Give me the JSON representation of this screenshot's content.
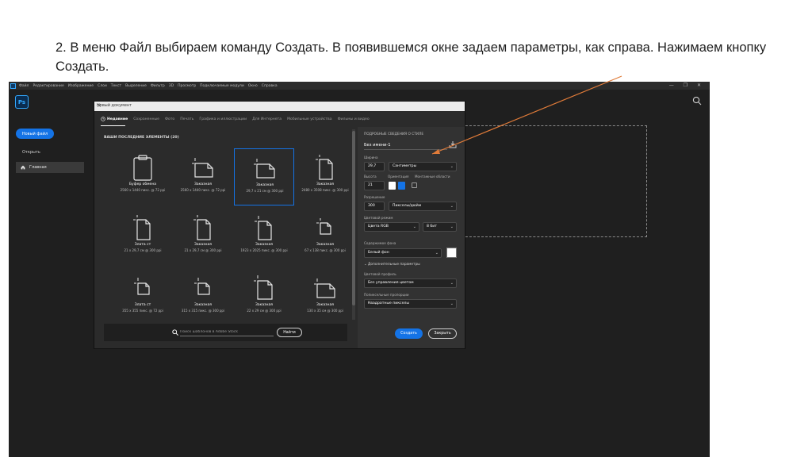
{
  "slide": {
    "instruction": "2. В меню Файл выбираем команду Создать. В появившемся окне задаем параметры, как справа. Нажимаем кнопку Создать."
  },
  "menubar": {
    "items": [
      "Файл",
      "Редактирование",
      "Изображение",
      "Слои",
      "Текст",
      "Выделение",
      "Фильтр",
      "3D",
      "Просмотр",
      "Подключаемые модули",
      "Окно",
      "Справка"
    ],
    "window_controls": "— ❐ ✕"
  },
  "sidebar": {
    "logo": "Ps",
    "new_file": "Новый файл",
    "open": "Открыть",
    "home": "Главная"
  },
  "dialog": {
    "title": "Новый документ",
    "close": "×",
    "tabs": [
      "Недавние",
      "Сохраненные",
      "Фото",
      "Печать",
      "Графика и иллюстрации",
      "Для Интернета",
      "Мобильные устройства",
      "Фильмы и видео"
    ],
    "section_header": "ВАШИ ПОСЛЕДНИЕ ЭЛЕМЕНТЫ (20)",
    "presets": [
      {
        "name": "Буфер обмена",
        "desc": "2560 x 1440 пикс. @ 72 ppi"
      },
      {
        "name": "Заказная",
        "desc": "2560 x 1440 пикс. @ 72 ppi"
      },
      {
        "name": "Заказная",
        "desc": "29,7 x 21 см @ 300 ppi"
      },
      {
        "name": "Заказная",
        "desc": "2480 x 3508 пикс. @ 300 ppi"
      },
      {
        "name": "Злата ст",
        "desc": "21 x 29,7 см @ 300 ppi"
      },
      {
        "name": "Заказная",
        "desc": "21 x 29,7 см @ 300 ppi"
      },
      {
        "name": "Заказная",
        "desc": "1923 x 2025 пикс. @ 300 ppi"
      },
      {
        "name": "Заказная",
        "desc": "67 x 138 пикс. @ 300 ppi"
      },
      {
        "name": "Злата ст",
        "desc": "355 x 355 пикс. @ 72 ppi"
      },
      {
        "name": "Заказная",
        "desc": "315 x 315 пикс. @ 300 ppi"
      },
      {
        "name": "Заказная",
        "desc": "22 x 29 см @ 300 ppi"
      },
      {
        "name": "Заказная",
        "desc": "130 x 35 см @ 300 ppi"
      }
    ],
    "search_placeholder": "Поиск шаблонов в Adobe Stock",
    "find_button": "Найти"
  },
  "details": {
    "header": "ПОДРОБНЫЕ СВЕДЕНИЯ О СТИЛЕ",
    "name": "Без имени-1",
    "width_label": "Ширина",
    "width_value": "29,7",
    "width_unit": "Сантиметры",
    "height_label": "Высота",
    "height_value": "21",
    "orientation_label": "Ориентация",
    "artboards_label": "Монтажные области",
    "resolution_label": "Разрешение",
    "resolution_value": "300",
    "resolution_unit": "Пикселы/дюйм",
    "color_mode_label": "Цветовой режим",
    "color_mode_value": "Цвета RGB",
    "bit_depth": "8 бит",
    "background_label": "Содержимое фона",
    "background_value": "Белый фон",
    "advanced": "Дополнительные параметры",
    "color_profile_label": "Цветовой профиль",
    "color_profile_value": "Без управления цветом",
    "pixel_aspect_label": "Попиксельные пропорции",
    "pixel_aspect_value": "Квадратные пикселы",
    "create_button": "Создать",
    "close_button": "Закрыть"
  },
  "colors": {
    "accent": "#1473e6",
    "arrow": "#e07b39",
    "workspace": "#1f1f1f",
    "dialog": "#2b2b2b"
  }
}
